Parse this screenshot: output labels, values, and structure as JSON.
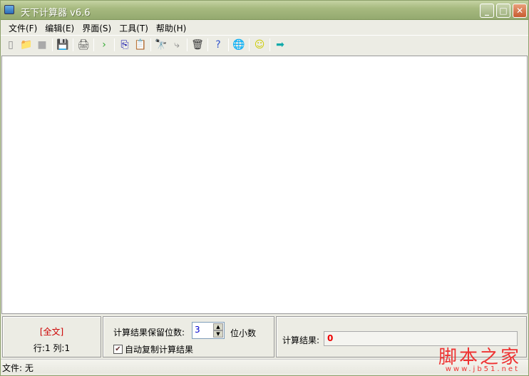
{
  "title": "天下计算器 v6.6",
  "window_buttons": {
    "minimize": "_",
    "maximize": "□",
    "close": "✕"
  },
  "menu": [
    "文件(F)",
    "编辑(E)",
    "界面(S)",
    "工具(T)",
    "帮助(H)"
  ],
  "toolbar": [
    {
      "name": "new-icon",
      "glyph": "▯",
      "color": "#888"
    },
    {
      "name": "open-folder-icon",
      "glyph": "📁",
      "color": "#cc9"
    },
    {
      "name": "save-icon",
      "glyph": "■",
      "color": "#aaa"
    },
    "sep",
    {
      "name": "save-all-icon",
      "glyph": "💾",
      "color": "#335"
    },
    "sep",
    {
      "name": "print-icon",
      "glyph": "🖨",
      "color": "#555"
    },
    "sep",
    {
      "name": "run-icon",
      "glyph": "›",
      "color": "#3a3"
    },
    "sep",
    {
      "name": "copy-icon",
      "glyph": "⎘",
      "color": "#00a"
    },
    {
      "name": "paste-icon",
      "glyph": "📋",
      "color": "#860"
    },
    "sep",
    {
      "name": "find-icon",
      "glyph": "🔭",
      "color": "#000"
    },
    {
      "name": "replace-icon",
      "glyph": "⤷",
      "color": "#888"
    },
    "sep",
    {
      "name": "delete-icon",
      "glyph": "🗑",
      "color": "#333"
    },
    "sep",
    {
      "name": "help-icon",
      "glyph": "?",
      "color": "#35c"
    },
    "sep",
    {
      "name": "globe-icon",
      "glyph": "🌐",
      "color": "#2a7"
    },
    "sep",
    {
      "name": "smiley-icon",
      "glyph": "☺",
      "color": "#cc0"
    },
    "sep",
    {
      "name": "exit-arrow-icon",
      "glyph": "➡",
      "color": "#1aa"
    }
  ],
  "left_panel": {
    "mode": "[全文]",
    "position": "行:1 列:1"
  },
  "middle_panel": {
    "decimals_label": "计算结果保留位数:",
    "decimals_value": "3",
    "decimals_suffix": "位小数",
    "auto_copy_label": "自动复制计算结果",
    "auto_copy_checked": true
  },
  "right_panel": {
    "result_label": "计算结果:",
    "result_value": "0"
  },
  "status": "文件: 无",
  "watermark": {
    "text": "脚本之家",
    "url": "www.jb51.net"
  }
}
